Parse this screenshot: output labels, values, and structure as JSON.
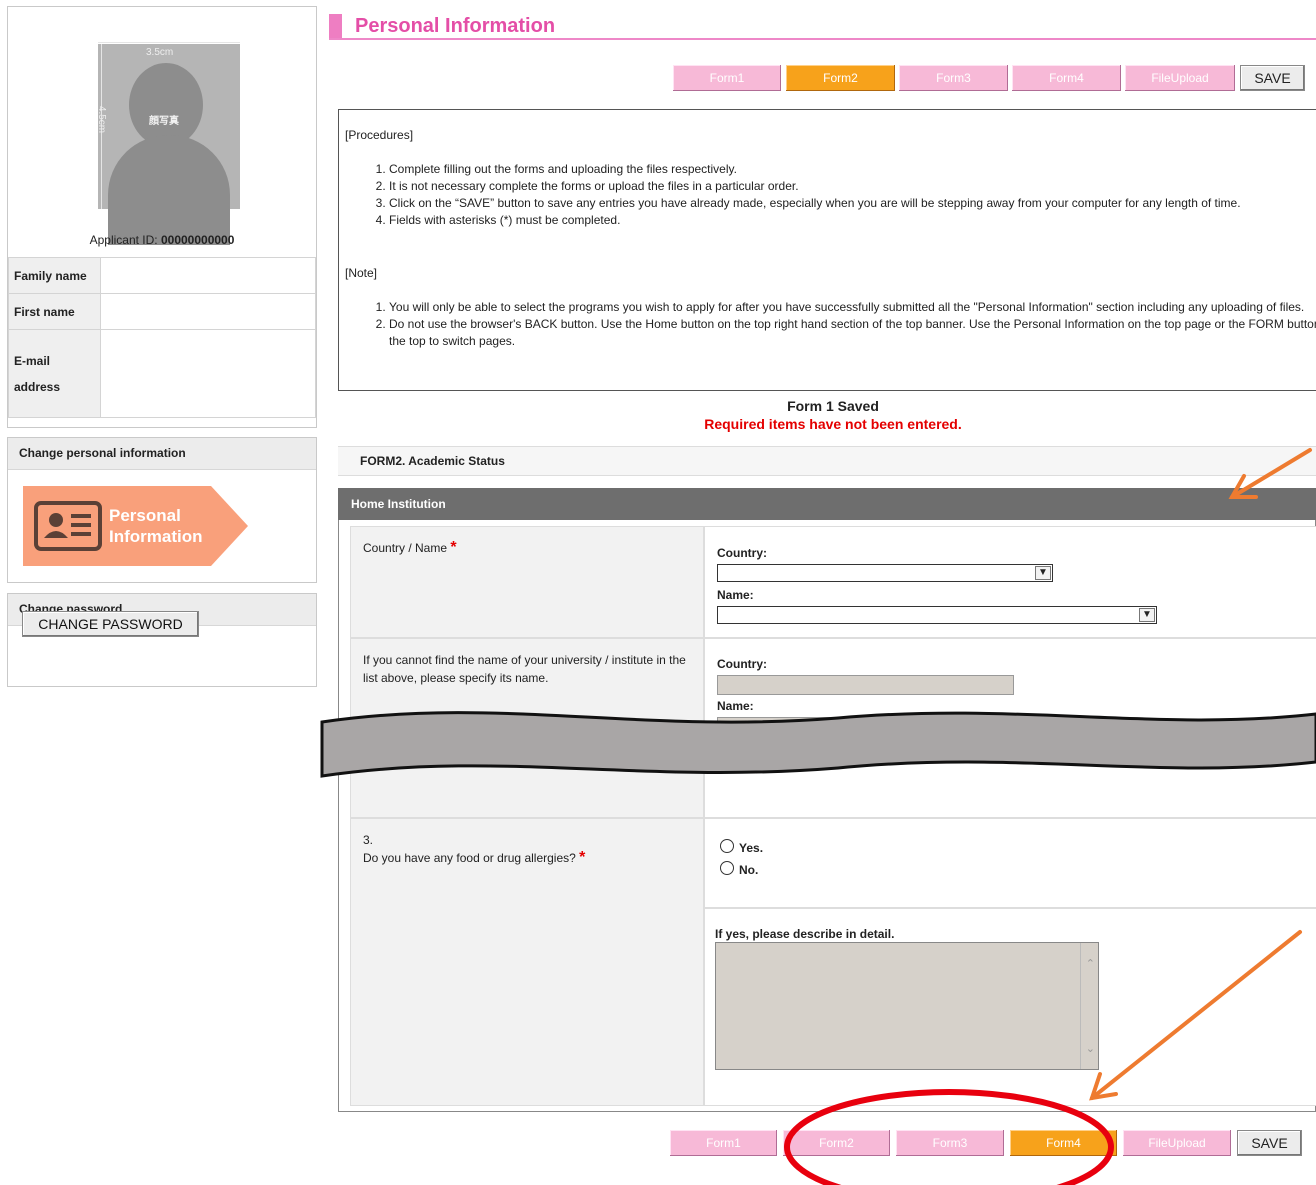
{
  "page_title": "Personal Information",
  "profile": {
    "photo_width_label": "3.5cm",
    "photo_height_label": "4.5cm",
    "photo_caption": "顔写真",
    "applicant_id_label": "Applicant ID:",
    "applicant_id_value": "00000000000",
    "fields": [
      {
        "label": "Family name",
        "value": ""
      },
      {
        "label": "First name",
        "value": ""
      },
      {
        "label": "E-mail address",
        "value": ""
      }
    ]
  },
  "sidebar": {
    "change_info_title": "Change personal information",
    "pi_banner_line1": "Personal",
    "pi_banner_line2": "Information",
    "change_password_title": "Change password",
    "change_password_button": "CHANGE PASSWORD"
  },
  "tabs_top": [
    {
      "label": "Form1",
      "active": false
    },
    {
      "label": "Form2",
      "active": true
    },
    {
      "label": "Form3",
      "active": false
    },
    {
      "label": "Form4",
      "active": false
    },
    {
      "label": "FileUpload",
      "active": false
    }
  ],
  "tabs_bottom": [
    {
      "label": "Form1",
      "active": false
    },
    {
      "label": "Form2",
      "active": false
    },
    {
      "label": "Form3",
      "active": false
    },
    {
      "label": "Form4",
      "active": true
    },
    {
      "label": "FileUpload",
      "active": false
    }
  ],
  "save_label": "SAVE",
  "procedures": {
    "heading": "[Procedures]",
    "items": [
      "Complete filling out the forms and uploading the files respectively.",
      "It is not necessary complete the forms or upload the files in a particular order.",
      "Click on the “SAVE” button to save any entries you have already made, especially when you are will be stepping away from your computer for any length of time.",
      "Fields with asterisks (*) must be completed."
    ],
    "note_heading": "[Note]",
    "notes": [
      "You will only be able to select the programs you wish to apply for after you have successfully submitted all the \"Personal Information\" section including any uploading of files.",
      "Do not use the browser's BACK button. Use the Home button on the top right hand section of the top banner. Use the Personal Information on the top page or the FORM buttons at the top to switch pages."
    ]
  },
  "status": {
    "saved": "Form 1 Saved",
    "required": "Required items have not been entered."
  },
  "form": {
    "title": "FORM2. Academic Status",
    "section": "Home Institution",
    "row1_label": "Country / Name",
    "country_label": "Country:",
    "name_label": "Name:",
    "row2_label": "If you cannot find the name of your university / institute in the list above, please specify its name.",
    "q3_number": "3.",
    "q3_label": "Do you have any food or drug allergies?",
    "yes_label": "Yes.",
    "no_label": "No.",
    "detail_label": "If yes, please describe in detail.",
    "required_mark": "*"
  },
  "colors": {
    "title_pink": "#e44ea7",
    "tab_pink": "#f7b9d7",
    "tab_orange": "#f7a21b",
    "required_red": "#e40000",
    "annotation_orange": "#ee7b30",
    "annotation_red": "#e8000e"
  }
}
